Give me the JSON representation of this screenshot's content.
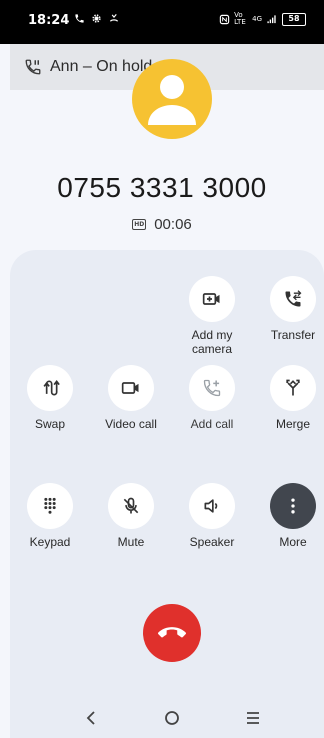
{
  "status_bar": {
    "time": "18:24",
    "left_icons": [
      "call-icon",
      "gear-icon",
      "missed-call-icon"
    ],
    "right_icons": [
      "nfc-icon",
      "volte-icon",
      "signal-icon",
      "lte-icon"
    ],
    "volte_text": "Vo LTE",
    "lte_text": "4G",
    "battery": "58"
  },
  "hold_banner": {
    "label": "Ann – On hold"
  },
  "call": {
    "number": "0755 3331 3000",
    "hd_badge": "HD",
    "duration": "00:06"
  },
  "actions": [
    {
      "id": "add-my-camera",
      "label": "Add my camera",
      "icon": "video-add-icon"
    },
    {
      "id": "transfer",
      "label": "Transfer",
      "icon": "call-transfer-icon"
    },
    {
      "id": "swap",
      "label": "Swap",
      "icon": "swap-calls-icon"
    },
    {
      "id": "video-call",
      "label": "Video call",
      "icon": "video-camera-icon"
    },
    {
      "id": "add-call",
      "label": "Add call",
      "icon": "add-call-icon"
    },
    {
      "id": "merge",
      "label": "Merge",
      "icon": "merge-icon"
    },
    {
      "id": "keypad",
      "label": "Keypad",
      "icon": "dialpad-icon"
    },
    {
      "id": "mute",
      "label": "Mute",
      "icon": "mic-off-icon"
    },
    {
      "id": "speaker",
      "label": "Speaker",
      "icon": "speaker-icon"
    },
    {
      "id": "more",
      "label": "More",
      "icon": "more-vertical-icon"
    }
  ],
  "colors": {
    "avatar": "#f6c232",
    "end_call": "#e0302c",
    "panel": "#e8ecf4",
    "more_button": "#41464e"
  },
  "nav": [
    "back-icon",
    "home-icon",
    "recents-icon"
  ]
}
